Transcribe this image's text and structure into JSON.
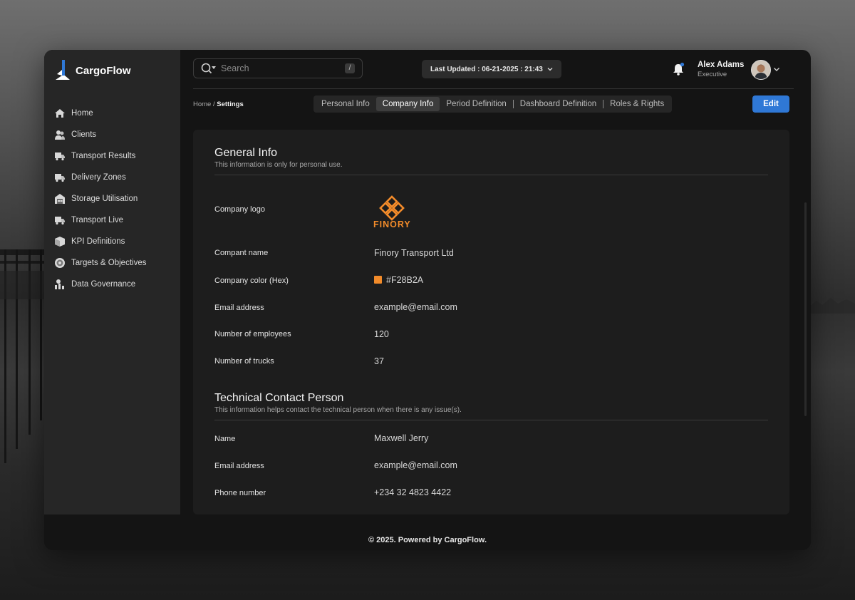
{
  "app": {
    "name": "CargoFlow"
  },
  "sidebar": {
    "items": [
      {
        "label": "Home",
        "icon": "home-icon"
      },
      {
        "label": "Clients",
        "icon": "users-icon"
      },
      {
        "label": "Transport Results",
        "icon": "truck-icon"
      },
      {
        "label": "Delivery Zones",
        "icon": "truck-icon"
      },
      {
        "label": "Storage Utilisation",
        "icon": "warehouse-icon"
      },
      {
        "label": "Transport Live",
        "icon": "truck-icon"
      },
      {
        "label": "KPI Definitions",
        "icon": "box-icon"
      },
      {
        "label": "Targets & Objectives",
        "icon": "target-icon"
      },
      {
        "label": "Data Governance",
        "icon": "chart-user-icon"
      }
    ]
  },
  "header": {
    "search_placeholder": "Search",
    "search_shortcut": "/",
    "last_updated": "Last Updated : 06-21-2025 : 21:43",
    "user_name": "Alex Adams",
    "user_role": "Executive"
  },
  "breadcrumb": {
    "home": "Home",
    "sep": "/",
    "current": "Settings"
  },
  "tabs": [
    {
      "label": "Personal Info"
    },
    {
      "label": "Company Info"
    },
    {
      "label": "Period Definition"
    },
    {
      "label": "Dashboard Definition"
    },
    {
      "label": "Roles & Rights"
    }
  ],
  "active_tab": "Company Info",
  "edit_label": "Edit",
  "general": {
    "title": "General Info",
    "subtitle": "This information is only for personal use.",
    "logo_label": "Company logo",
    "logo_word": "FINORY",
    "name_label": "Compant name",
    "name_value": "Finory Transport Ltd",
    "color_label": "Company color (Hex)",
    "color_value": "#F28B2A",
    "email_label": "Email address",
    "email_value": "example@email.com",
    "employees_label": "Number of employees",
    "employees_value": "120",
    "trucks_label": "Number of trucks",
    "trucks_value": "37"
  },
  "technical": {
    "title": "Technical Contact Person",
    "subtitle": "This information helps contact the technical person when there is any issue(s).",
    "name_label": "Name",
    "name_value": "Maxwell Jerry",
    "email_label": "Email address",
    "email_value": "example@email.com",
    "phone_label": "Phone number",
    "phone_value": "+234 32 4823 4422"
  },
  "footer": "© 2025. Powered by CargoFlow.",
  "colors": {
    "accent": "#2f78d6",
    "brand": "#F28B2A",
    "panel": "#1d1d1d",
    "sidebar": "#262626"
  }
}
